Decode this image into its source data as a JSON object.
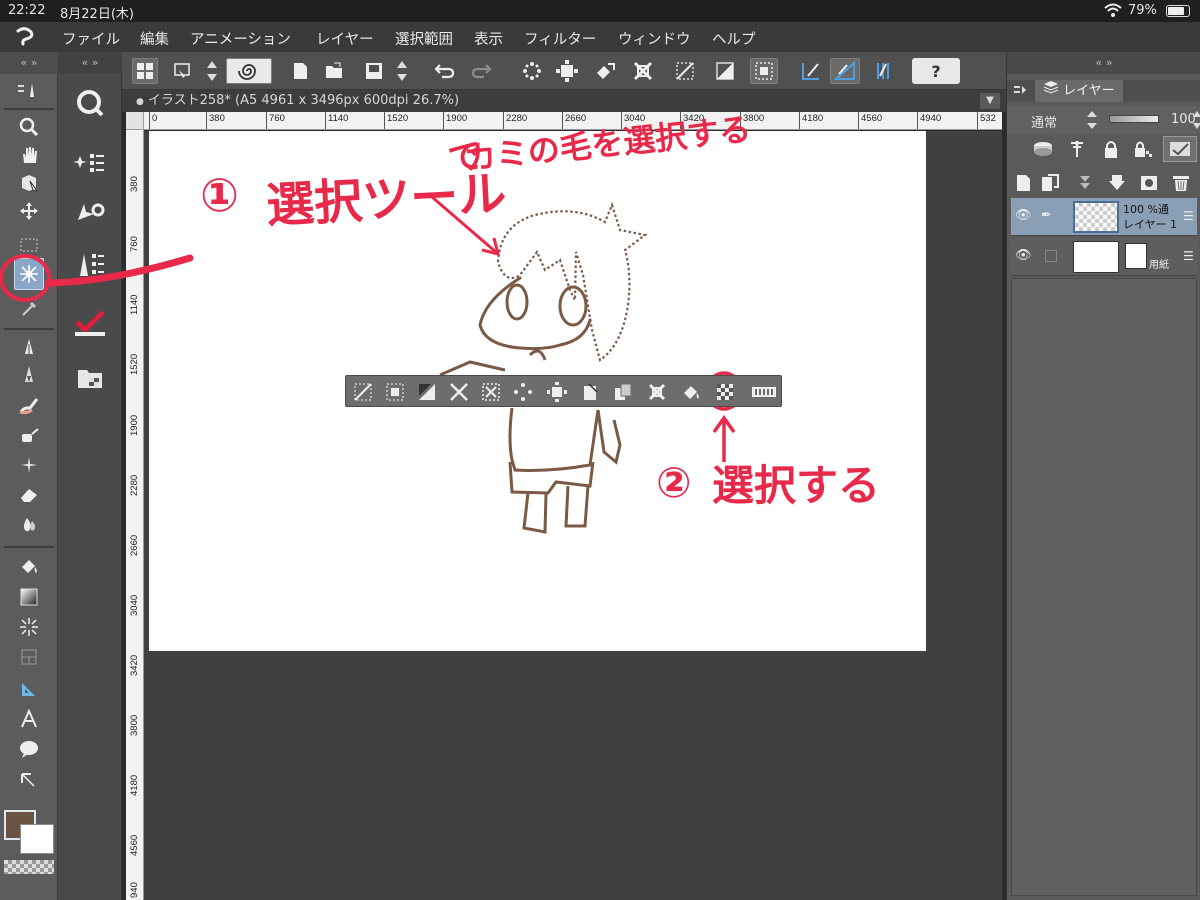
{
  "status_bar": {
    "time": "22:22",
    "date": "8月22日(木)",
    "battery": "79%"
  },
  "menubar": {
    "logo": "ゥ",
    "items": [
      "ファイル",
      "編集",
      "アニメーション",
      "レイヤー",
      "選択範囲",
      "表示",
      "フィルター",
      "ウィンドウ",
      "ヘルプ"
    ]
  },
  "panel_grip": "«  »",
  "document": {
    "tab_title": "イラスト258* (A5 4961 x 3496px 600dpi 26.7%)",
    "tab_dot": "●",
    "dropdown": "▼"
  },
  "ruler": {
    "top_ticks": [
      "0",
      "380",
      "760",
      "1140",
      "1520",
      "1900",
      "2280",
      "2660",
      "3040",
      "3420",
      "3800",
      "4180",
      "4560",
      "4940",
      "532"
    ],
    "left_ticks": [
      "380",
      "760",
      "1140",
      "1520",
      "1900",
      "2280",
      "2660",
      "3040",
      "3420",
      "3800",
      "4180",
      "4560",
      "940"
    ]
  },
  "layers_panel": {
    "tab_label": "レイヤー",
    "blend_mode": "通常",
    "opacity": "100",
    "layers": [
      {
        "percent": "100 %通",
        "name": "レイヤー 1",
        "active": true
      },
      {
        "percent": "",
        "name": "用紙",
        "active": false
      }
    ],
    "menu_glyph": "☰"
  },
  "icons": {
    "eye": "👁",
    "pen": "✒",
    "help": "?"
  },
  "annotations": {
    "step1_num": "①",
    "step1_text": "選択ツール",
    "step1_de": "で",
    "step1_sub": "カミの毛を選択する",
    "step2_num": "②",
    "step2_text": "選択する"
  },
  "colors": {
    "accent_annotation": "#e8294a",
    "main_color": "#6b5443",
    "selected_tool": "#88a6c6"
  }
}
